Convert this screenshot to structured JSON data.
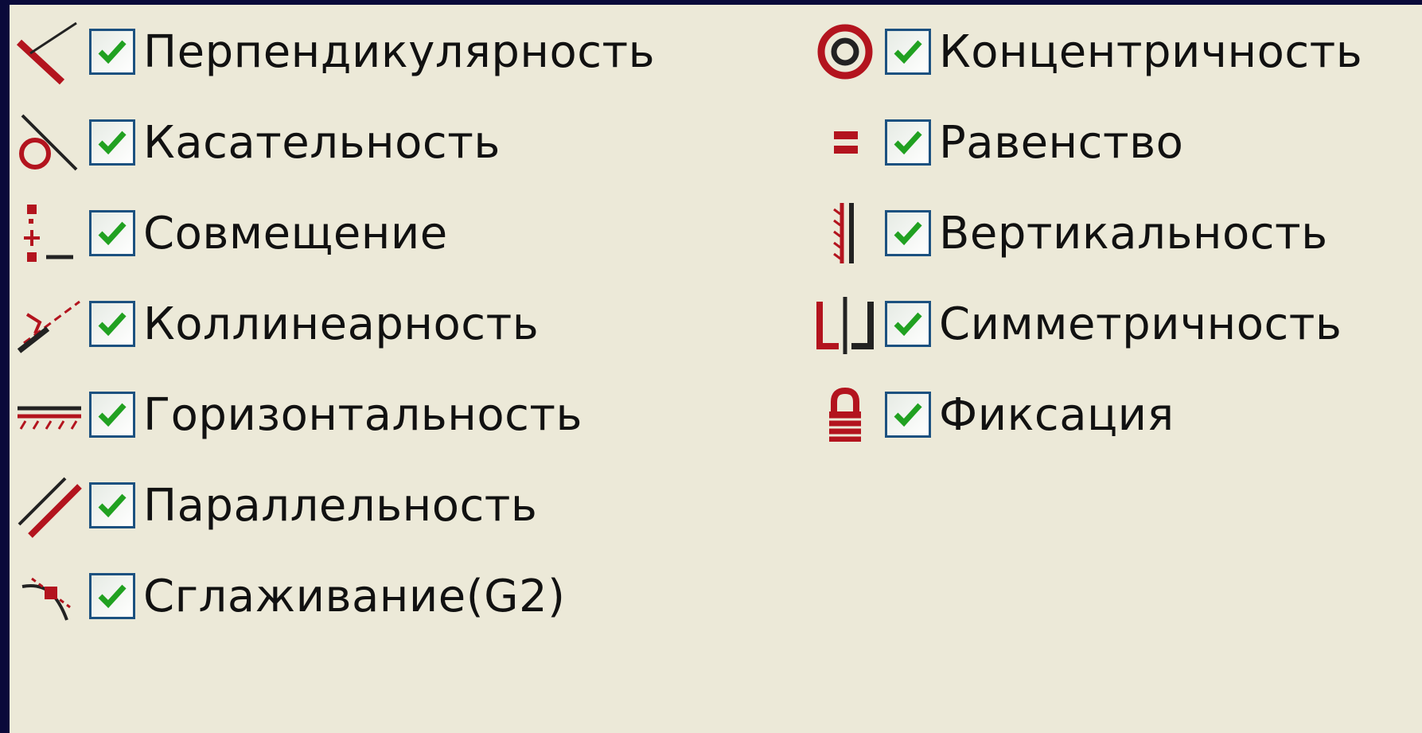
{
  "colors": {
    "frame": "#0a0a3a",
    "panel": "#ece9d8",
    "icon_red": "#b3141e",
    "icon_dark": "#222222",
    "checkbox_border": "#1c5180",
    "check_green": "#21a121"
  },
  "constraints_left": [
    {
      "icon": "perpendicular-icon",
      "label": "Перпендикулярность",
      "checked": true
    },
    {
      "icon": "tangent-icon",
      "label": "Касательность",
      "checked": true
    },
    {
      "icon": "coincident-icon",
      "label": "Совмещение",
      "checked": true
    },
    {
      "icon": "collinear-icon",
      "label": "Коллинеарность",
      "checked": true
    },
    {
      "icon": "horizontal-icon",
      "label": "Горизонтальность",
      "checked": true
    },
    {
      "icon": "parallel-icon",
      "label": "Параллельность",
      "checked": true
    },
    {
      "icon": "smooth-icon",
      "label": "Сглаживание(G2)",
      "checked": true
    }
  ],
  "constraints_right": [
    {
      "icon": "concentric-icon",
      "label": "Концентричность",
      "checked": true
    },
    {
      "icon": "equal-icon",
      "label": "Равенство",
      "checked": true
    },
    {
      "icon": "vertical-icon",
      "label": "Вертикальность",
      "checked": true
    },
    {
      "icon": "symmetric-icon",
      "label": "Симметричность",
      "checked": true
    },
    {
      "icon": "fix-lock-icon",
      "label": "Фиксация",
      "checked": true
    }
  ]
}
